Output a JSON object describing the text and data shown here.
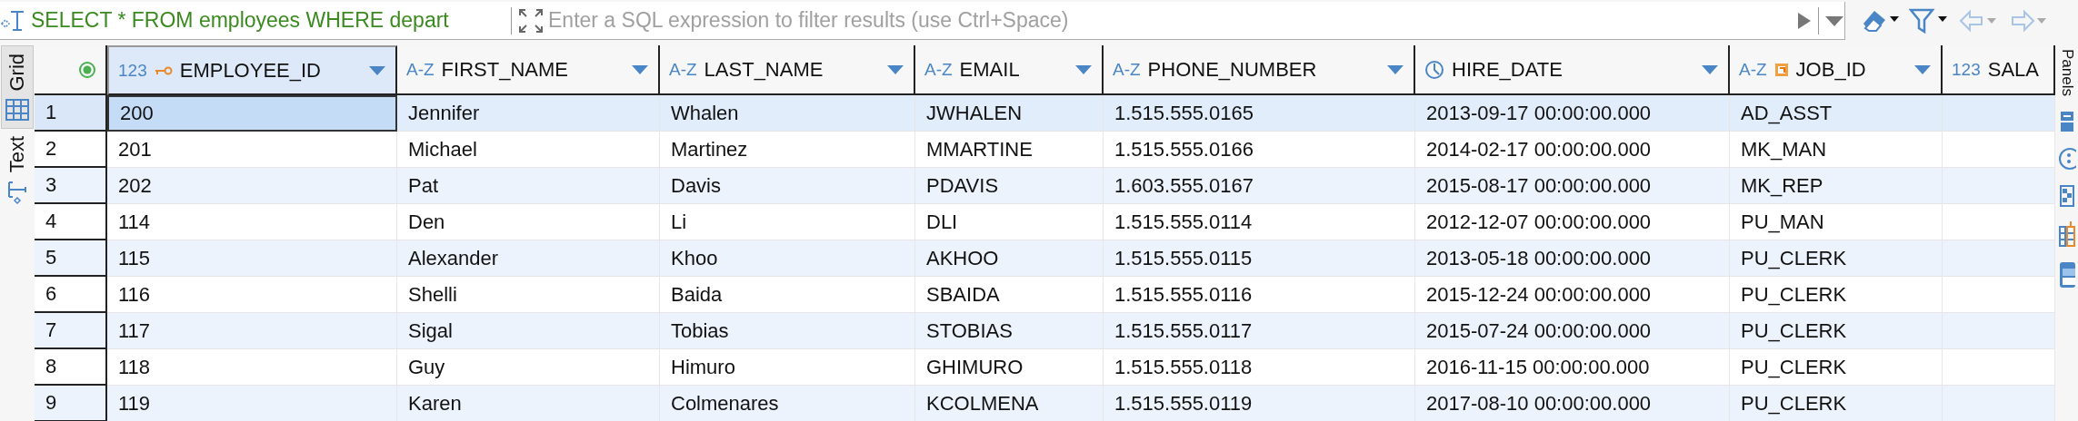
{
  "toolbar": {
    "query": "SELECT * FROM employees WHERE depart",
    "filter": {
      "placeholder": "Enter a SQL expression to filter results (use Ctrl+Space)"
    }
  },
  "view_tabs": [
    {
      "label": "Grid",
      "selected": true
    },
    {
      "label": "Text",
      "selected": false
    }
  ],
  "side_panel": {
    "title": "Panels"
  },
  "table": {
    "columns": [
      {
        "name": "EMPLOYEE_ID",
        "kind": "number",
        "type_label": "123",
        "primary_key": true,
        "foreign_key": false,
        "focused": true
      },
      {
        "name": "FIRST_NAME",
        "kind": "text",
        "type_label": "A-Z",
        "focused": false
      },
      {
        "name": "LAST_NAME",
        "kind": "text",
        "type_label": "A-Z",
        "focused": false
      },
      {
        "name": "EMAIL",
        "kind": "text",
        "type_label": "A-Z",
        "focused": false
      },
      {
        "name": "PHONE_NUMBER",
        "kind": "text",
        "type_label": "A-Z",
        "focused": false
      },
      {
        "name": "HIRE_DATE",
        "kind": "date",
        "focused": false
      },
      {
        "name": "JOB_ID",
        "kind": "text",
        "type_label": "A-Z",
        "primary_key": false,
        "foreign_key": true,
        "focused": false
      },
      {
        "name": "SALA",
        "kind": "number",
        "type_label": "123",
        "focused": false
      }
    ],
    "rows": [
      {
        "number": "1",
        "selected": true,
        "cells": [
          "200",
          "Jennifer",
          "Whalen",
          "JWHALEN",
          "1.515.555.0165",
          "2013-09-17 00:00:00.000",
          "AD_ASST"
        ]
      },
      {
        "number": "2",
        "selected": false,
        "cells": [
          "201",
          "Michael",
          "Martinez",
          "MMARTINE",
          "1.515.555.0166",
          "2014-02-17 00:00:00.000",
          "MK_MAN"
        ]
      },
      {
        "number": "3",
        "selected": false,
        "cells": [
          "202",
          "Pat",
          "Davis",
          "PDAVIS",
          "1.603.555.0167",
          "2015-08-17 00:00:00.000",
          "MK_REP"
        ]
      },
      {
        "number": "4",
        "selected": false,
        "cells": [
          "114",
          "Den",
          "Li",
          "DLI",
          "1.515.555.0114",
          "2012-12-07 00:00:00.000",
          "PU_MAN"
        ]
      },
      {
        "number": "5",
        "selected": false,
        "cells": [
          "115",
          "Alexander",
          "Khoo",
          "AKHOO",
          "1.515.555.0115",
          "2013-05-18 00:00:00.000",
          "PU_CLERK"
        ]
      },
      {
        "number": "6",
        "selected": false,
        "cells": [
          "116",
          "Shelli",
          "Baida",
          "SBAIDA",
          "1.515.555.0116",
          "2015-12-24 00:00:00.000",
          "PU_CLERK"
        ]
      },
      {
        "number": "7",
        "selected": false,
        "cells": [
          "117",
          "Sigal",
          "Tobias",
          "STOBIAS",
          "1.515.555.0117",
          "2015-07-24 00:00:00.000",
          "PU_CLERK"
        ]
      },
      {
        "number": "8",
        "selected": false,
        "cells": [
          "118",
          "Guy",
          "Himuro",
          "GHIMURO",
          "1.515.555.0118",
          "2016-11-15 00:00:00.000",
          "PU_CLERK"
        ]
      },
      {
        "number": "9",
        "selected": false,
        "cells": [
          "119",
          "Karen",
          "Colmenares",
          "KCOLMENA",
          "1.515.555.0119",
          "2017-08-10 00:00:00.000",
          "PU_CLERK"
        ]
      }
    ]
  }
}
